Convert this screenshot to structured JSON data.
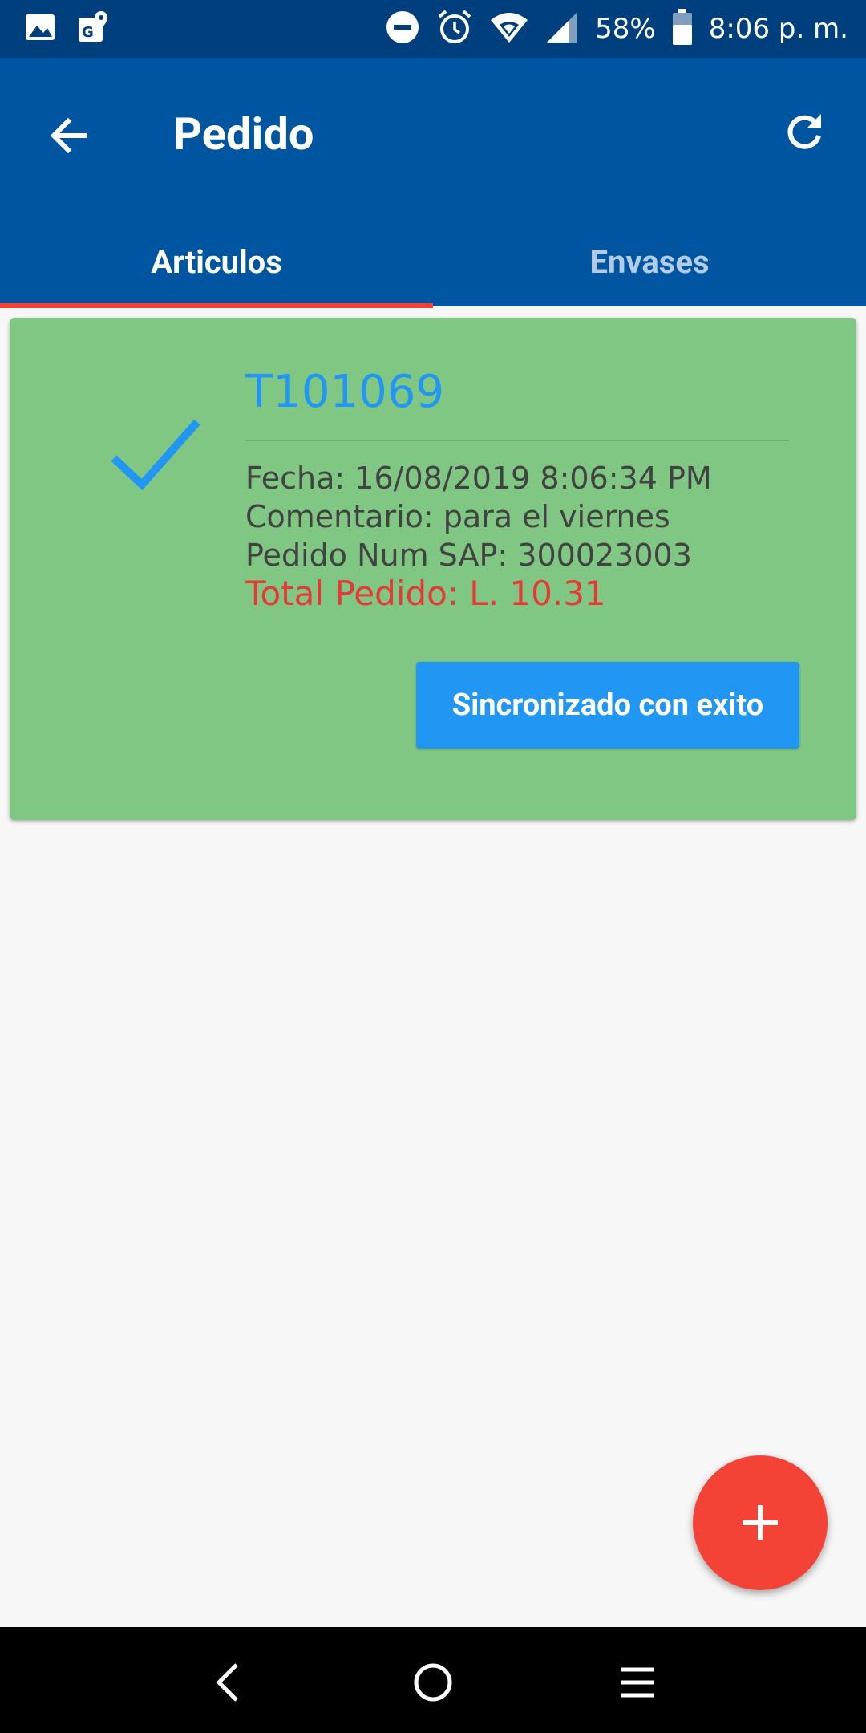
{
  "status_bar": {
    "battery": "58%",
    "time": "8:06 p. m.",
    "icons": [
      "gallery-icon",
      "maps-notification-icon",
      "do-not-disturb-icon",
      "alarm-icon",
      "wifi-icon",
      "signal-icon",
      "battery-icon"
    ]
  },
  "appbar": {
    "title": "Pedido",
    "back_icon": "arrow-back-icon",
    "refresh_icon": "refresh-icon"
  },
  "tabs": [
    {
      "label": "Articulos",
      "active": true
    },
    {
      "label": "Envases",
      "active": false
    }
  ],
  "order": {
    "code": "T101069",
    "fecha": "Fecha: 16/08/2019 8:06:34 PM",
    "comentario": "Comentario: para el viernes",
    "sap": "Pedido Num SAP: 300023003",
    "total": "Total Pedido: L. 10.31",
    "sync_button": "Sincronizado con exito",
    "status_icon": "checkmark-icon"
  },
  "fab": {
    "icon": "plus-icon"
  },
  "colors": {
    "appbar": "#0055a1",
    "statusbar": "#003f7d",
    "card": "#81c784",
    "accent_blue": "#2196f3",
    "accent_red": "#f44336"
  }
}
